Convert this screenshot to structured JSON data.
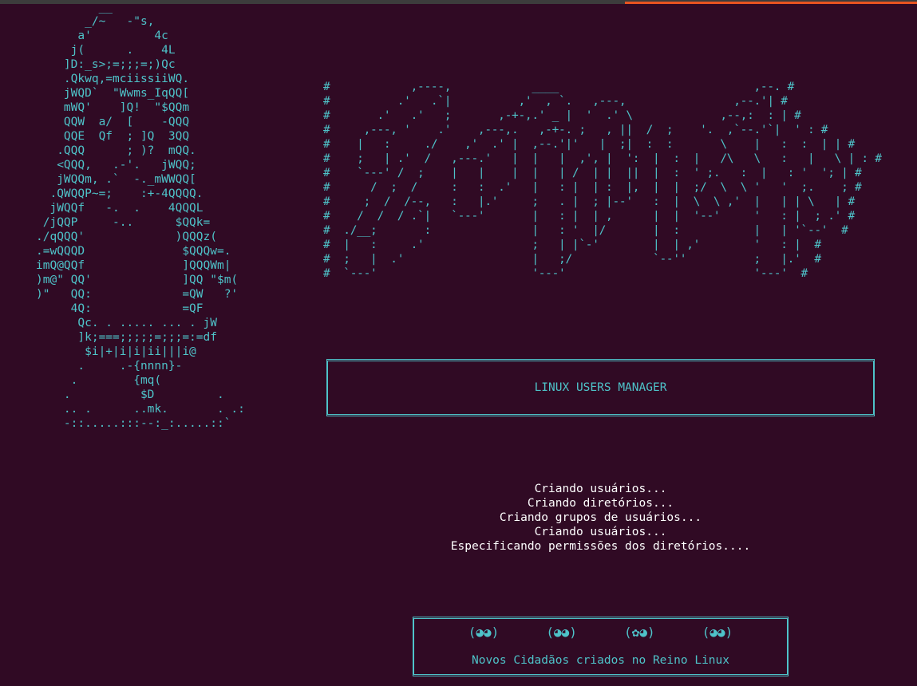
{
  "tux_ascii": "         __\n       _/~   -\"s,\n      a'         4c\n     j(      .    4L\n    ]D:_s>;=;;;=;)Qc\n    .Qkwq,=mciissiiWQ.\n    jWQD`  \"Wwms_IqQQ[\n    mWQ'    ]Q!  \"$QQm\n    QQW  a/  [    -QQQ\n    QQE  Qf  ; ]Q  3QQ\n   .QQQ      ; )?  mQQ.\n   <QQQ,   .-'.   jWQQ;\n   jWQQm, .`  -._mWWQQ[\n  .QWQQP~=;    :+-4QQQQ.\n  jWQQf   -.  .    4QQQL\n /jQQP     -..      $QQk=\n./qQQQ'             )QQQz(\n.=wQQQD              $QQQw=.\nimQ@QQf              ]QQQWm|\n)m@\" QQ'             ]QQ \"$m(\n)\"   QQ:             =QW   ?'\n     4Q:             =QF\n      Qc. . ..... ... . jW\n      ]k;===;;;;;=;;;=:=df\n       $i|+|i|i|ii|||i@\n      .     .-{nnnn}-\n     .        {mq(\n    .          $D         .\n    .. .      ..mk.       . .:\n    -::.....:::--:_:.....::`",
  "banner_ascii": "#            ,----,            ____                             ,--. #\n#          .'   .`|          ,'  , `.   ,---,                ,--.'| #\n#       .'   .'   ;       ,-+-,.' _ |  '  .' \\             ,--,:  : | #\n#     ,---, '    .'    ,---,.   ,-+-. ;   , ||  /  ;    '.  ,`--.'`|  ' : #\n#    |   :     ./    ,'  .' |  ,--.'|'   |  ;|  :  :       \\    |   :  :  | | #\n#    ;   | .'  /   ,---.'   |  |   |  ,', |  ':  |  :  |   /\\   \\   :   |   \\ | : #\n#    `---' /  ;    |   |    |  |   | /  | |  ||  |  :  ' ;.   :  |   : '  '; | #\n#      /  ;  /     :   :  .'   |   : |  | :  |,  |  |  ;/  \\  \\ '   '  ;.    ; #\n#     ;  /  /--,   :   |.'     ;   . |  ; |--'   :  |  \\  \\ ,'  |   | | \\   | #\n#    /  /  / .`|   `---'       |   : |  | ,      |  |  '--'     '   : |  ; .' #\n#  ./__;       :               |   : '  |/       |  :           |   | '`--'  #\n#  |   :     .'                ;   | |`-'        |  | ,'        '   : |  #\n#  ;   |  .'                   |   ;/            `--''          ;   |.'  #\n#  `---'                       '---'                            '---'  #",
  "title": "LINUX USERS MANAGER",
  "status_lines": [
    "Criando usuários...",
    "Criando diretórios...",
    "Criando grupos de usuários...",
    "Criando usuários...",
    "Especificando permissões dos diretórios...."
  ],
  "footer": {
    "emojis": [
      "(◕◕)",
      "(◕◕)",
      "(✿◕)",
      "(◕◕)"
    ],
    "message": "Novos Cidadãos criados no Reino Linux"
  },
  "colors": {
    "background": "#300a24",
    "cyan": "#4ec3c9",
    "text": "#ffffff",
    "accent": "#e95420"
  }
}
